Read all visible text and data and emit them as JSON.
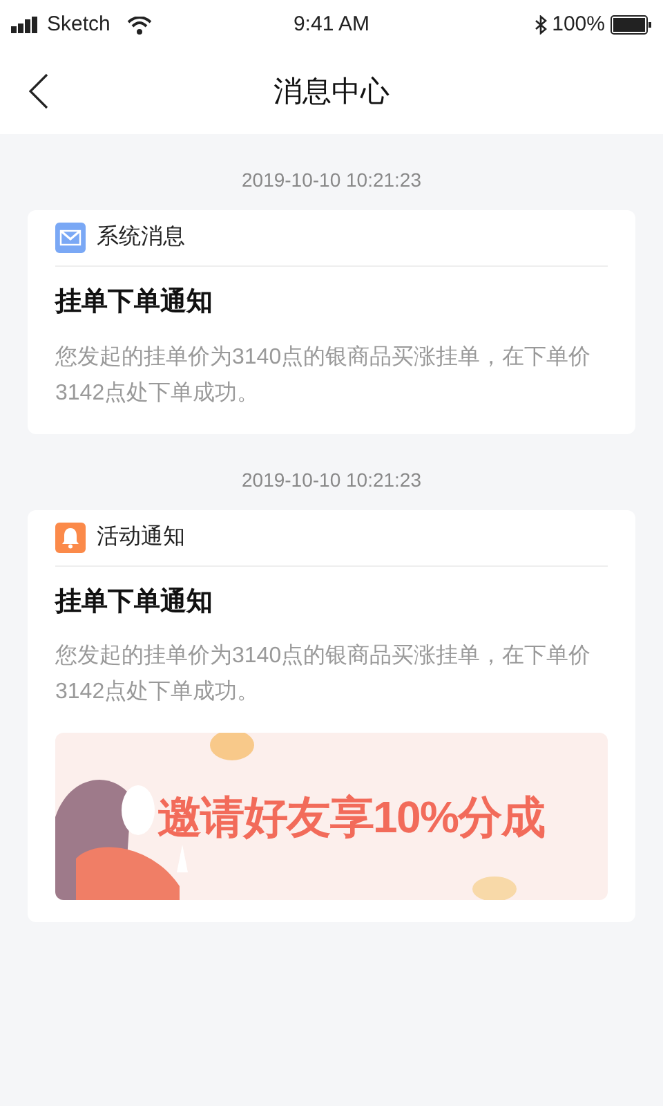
{
  "status_bar": {
    "carrier": "Sketch",
    "time": "9:41 AM",
    "battery": "100%"
  },
  "nav": {
    "title": "消息中心"
  },
  "messages": [
    {
      "time": "2019-10-10  10:21:23",
      "kind": "system",
      "category": "系统消息",
      "title": "挂单下单通知",
      "body": "您发起的挂单价为3140点的银商品买涨挂单，在下单价3142点处下单成功。"
    },
    {
      "time": "2019-10-10  10:21:23",
      "kind": "activity",
      "category": "活动通知",
      "title": "挂单下单通知",
      "body": "您发起的挂单价为3140点的银商品买涨挂单，在下单价3142点处下单成功。",
      "banner": {
        "text": "邀请好友享10%分成"
      }
    }
  ]
}
